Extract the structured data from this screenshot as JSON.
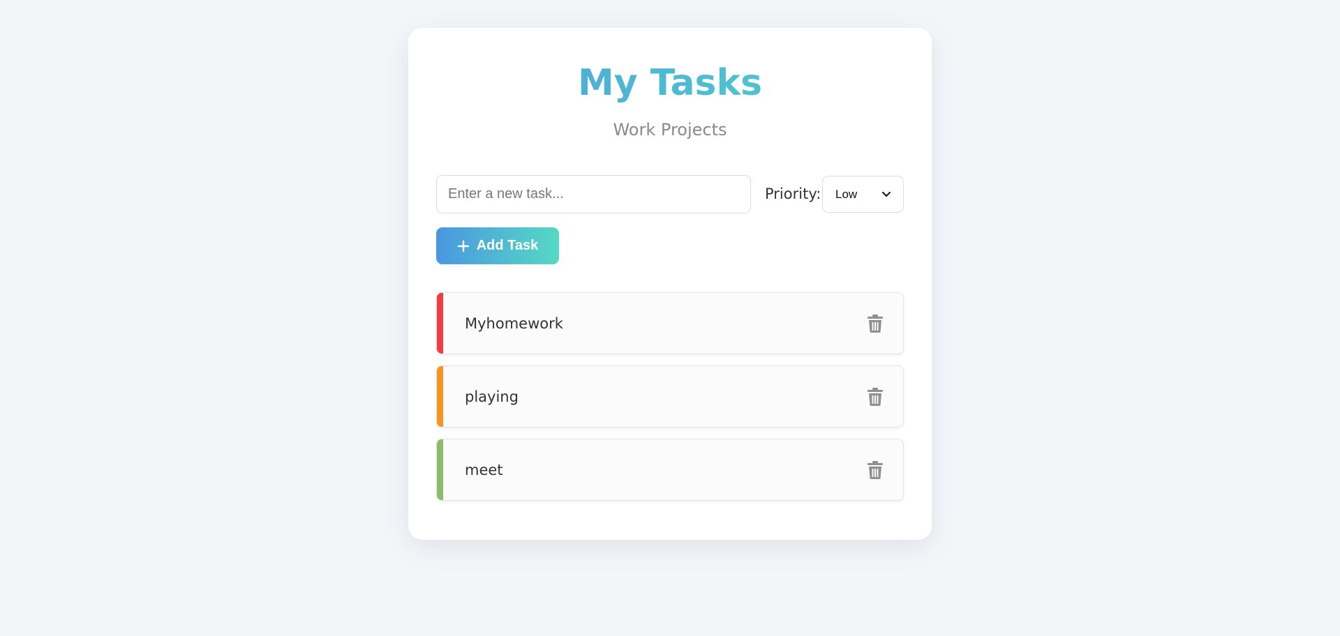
{
  "header": {
    "title": "My Tasks",
    "subtitle": "Work Projects"
  },
  "form": {
    "task_placeholder": "Enter a new task...",
    "task_value": "",
    "priority_label": "Priority:",
    "priority_selected": "Low",
    "add_button_label": "Add Task"
  },
  "tasks": [
    {
      "text": "Myhomework",
      "priority_color": "#f23c44"
    },
    {
      "text": "playing",
      "priority_color": "#f5941e"
    },
    {
      "text": "meet",
      "priority_color": "#8cbc68"
    }
  ],
  "icons": {
    "add": "plus-icon",
    "delete": "trash-icon",
    "select": "chevron-down-icon"
  },
  "colors": {
    "accent_start": "#4a97e0",
    "accent_end": "#55d9c5",
    "background": "#f3f6f9"
  }
}
